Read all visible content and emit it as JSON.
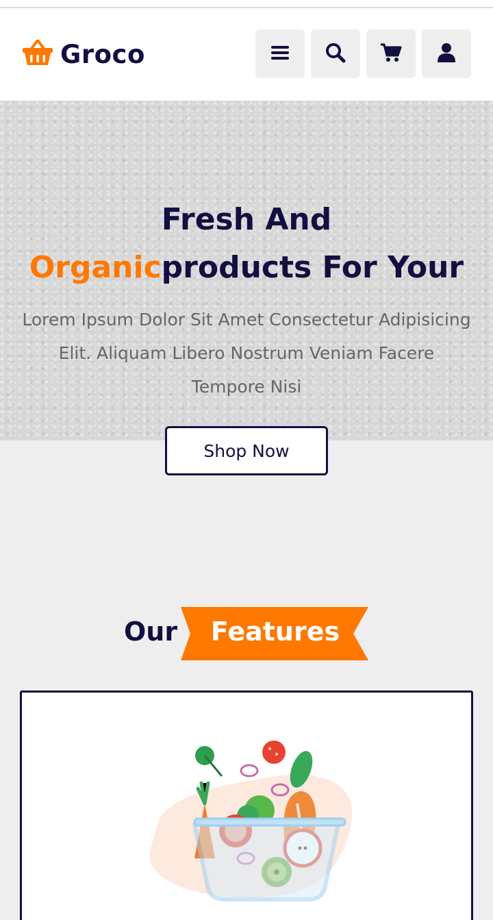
{
  "header": {
    "logo_icon": "basket-icon",
    "logo_text": "Groco",
    "buttons": [
      {
        "icon": "menu-icon"
      },
      {
        "icon": "search-icon"
      },
      {
        "icon": "cart-icon"
      },
      {
        "icon": "user-icon"
      }
    ]
  },
  "hero": {
    "title_line1": "Fresh And",
    "title_highlight": "Organic",
    "title_rest": "products For Your",
    "description": "Lorem Ipsum Dolor Sit Amet Consectetur Adipisicing Elit. Aliquam Libero Nostrum Veniam Facere Tempore Nisi",
    "cta_label": "Shop Now"
  },
  "features": {
    "heading_plain": "Our",
    "heading_highlight": "Features",
    "card_image": "salad-bowl-illustration"
  },
  "colors": {
    "accent": "#ff7800",
    "dark": "#130f40",
    "text_muted": "#666666",
    "background": "#eeeeee"
  }
}
